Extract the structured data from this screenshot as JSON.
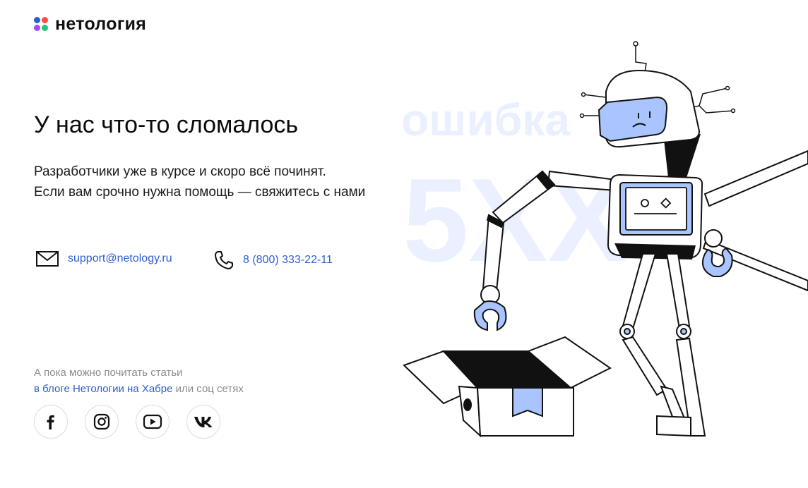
{
  "brand": {
    "name": "нетология",
    "dot_colors": [
      "#2e5fd0",
      "#ff4b4b",
      "#27c27c",
      "#a24bff"
    ]
  },
  "error": {
    "title": "У нас что-то сломалось",
    "line1": "Разработчики уже в курсе и скоро всё починят.",
    "line2": "Если вам срочно нужна помощь — свяжитесь с нами",
    "bg_word": "ошибка",
    "bg_code": "5XX"
  },
  "contacts": {
    "email": {
      "icon": "envelope-icon",
      "text": "support@netology.ru"
    },
    "phone": {
      "icon": "phone-icon",
      "text": "8 (800) 333-22-11"
    }
  },
  "footer_note": {
    "line1": "А пока можно почитать статьи",
    "link": "в блоге Нетологии на Хабре",
    "suffix": " или соц сетях"
  },
  "socials": [
    {
      "name": "facebook",
      "icon": "facebook-icon"
    },
    {
      "name": "instagram",
      "icon": "instagram-icon"
    },
    {
      "name": "youtube",
      "icon": "youtube-icon"
    },
    {
      "name": "vk",
      "icon": "vk-icon"
    }
  ],
  "colors": {
    "accent": "#2e5fd0",
    "robot_fill": "#a9c4ff",
    "watermark": "#eaf0ff"
  }
}
